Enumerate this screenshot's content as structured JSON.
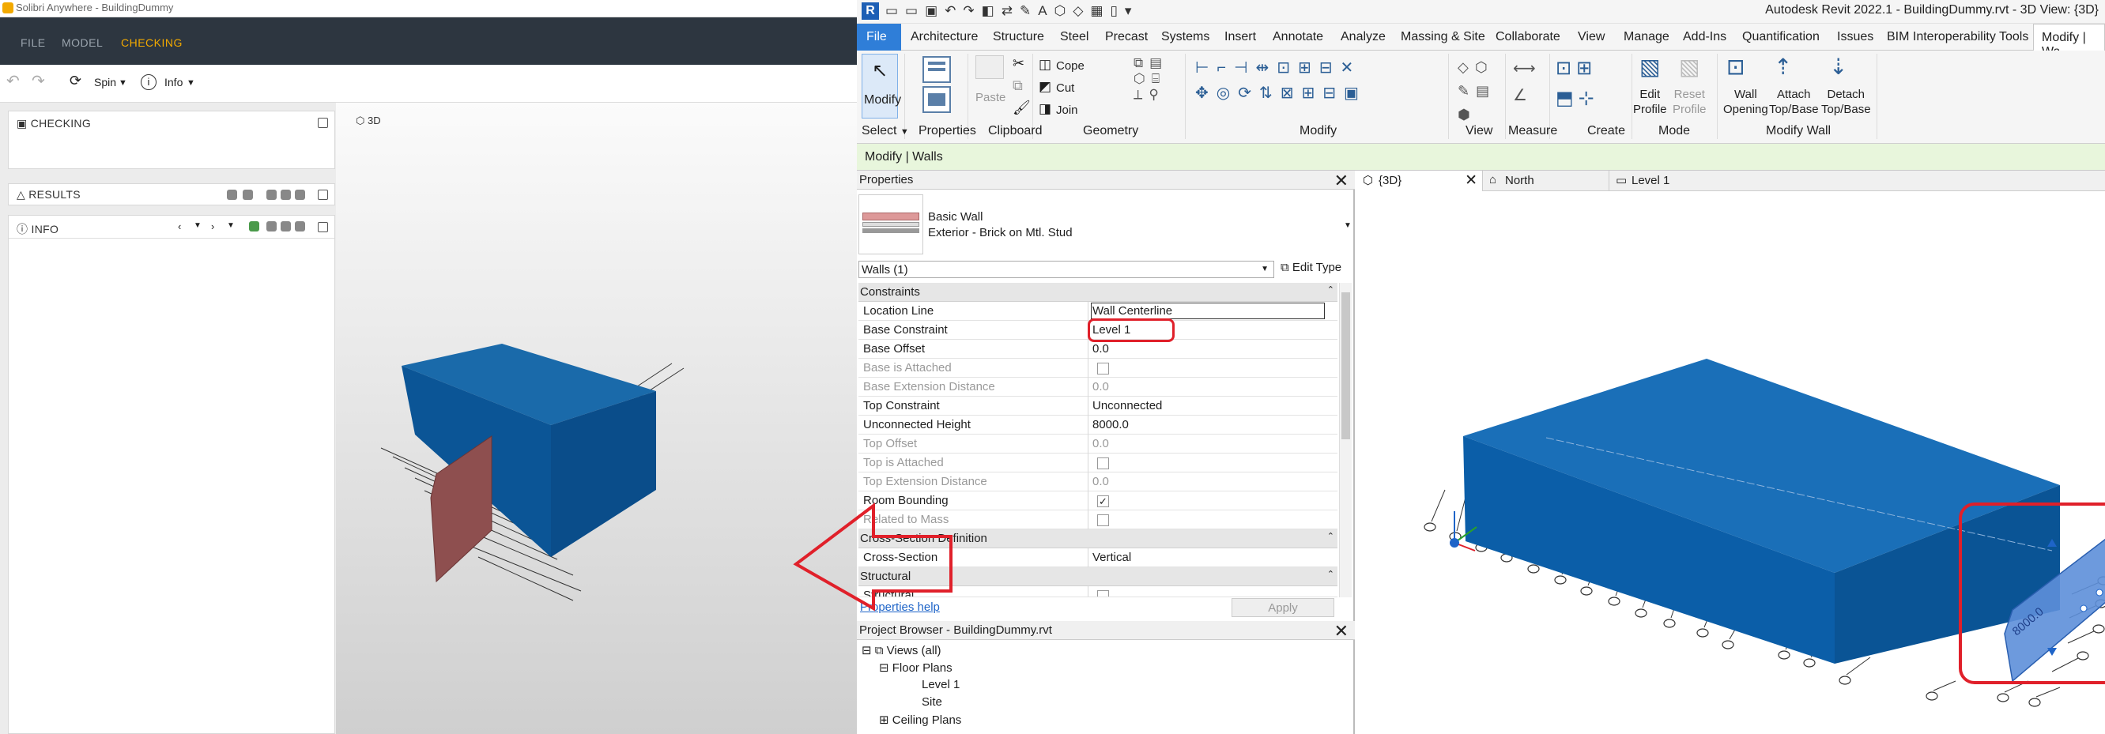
{
  "solibri": {
    "title": "Solibri Anywhere - BuildingDummy",
    "menu": [
      "FILE",
      "MODEL",
      "CHECKING"
    ],
    "toolbar": {
      "spin": "Spin",
      "info": "Info"
    },
    "panels": {
      "checking": "CHECKING",
      "results": "RESULTS",
      "info": "INFO"
    },
    "view_label": "3D"
  },
  "revit": {
    "title": "Autodesk Revit 2022.1 - BuildingDummy.rvt - 3D View: {3D}",
    "tabs": [
      "File",
      "Architecture",
      "Structure",
      "Steel",
      "Precast",
      "Systems",
      "Insert",
      "Annotate",
      "Analyze",
      "Massing & Site",
      "Collaborate",
      "View",
      "Manage",
      "Add-Ins",
      "Quantification",
      "Issues",
      "BIM Interoperability Tools",
      "Modify | Wa"
    ],
    "ribbon": {
      "modify": "Modify",
      "paste": "Paste",
      "cope": "Cope",
      "cut": "Cut",
      "join": "Join",
      "edit_profile": "Edit\nProfile",
      "reset_profile": "Reset\nProfile",
      "wall_opening": "Wall\nOpening",
      "attach": "Attach\nTop/Base",
      "detach": "Detach\nTop/Base",
      "groups": [
        "Select",
        "Properties",
        "Clipboard",
        "Geometry",
        "Modify",
        "View",
        "Measure",
        "Create",
        "Mode",
        "Modify Wall"
      ]
    },
    "context_bar": "Modify | Walls",
    "properties": {
      "title": "Properties",
      "type_family": "Basic Wall",
      "type_name": "Exterior - Brick on Mtl. Stud",
      "selector": "Walls (1)",
      "edit_type": "Edit Type",
      "categories": {
        "constraints": "Constraints",
        "cross_section": "Cross-Section Definition",
        "structural": "Structural"
      },
      "rows": [
        {
          "name": "Location Line",
          "value": "Wall Centerline"
        },
        {
          "name": "Base Constraint",
          "value": "Level 1"
        },
        {
          "name": "Base Offset",
          "value": "0.0"
        },
        {
          "name": "Base is Attached",
          "value": ""
        },
        {
          "name": "Base Extension Distance",
          "value": "0.0"
        },
        {
          "name": "Top Constraint",
          "value": "Unconnected"
        },
        {
          "name": "Unconnected Height",
          "value": "8000.0"
        },
        {
          "name": "Top Offset",
          "value": "0.0"
        },
        {
          "name": "Top is Attached",
          "value": ""
        },
        {
          "name": "Top Extension Distance",
          "value": "0.0"
        },
        {
          "name": "Room Bounding",
          "value": ""
        },
        {
          "name": "Related to Mass",
          "value": ""
        },
        {
          "name": "Cross-Section",
          "value": "Vertical"
        },
        {
          "name": "Structural",
          "value": ""
        }
      ],
      "help": "Properties help",
      "apply": "Apply"
    },
    "project_browser": {
      "title": "Project Browser - BuildingDummy.rvt",
      "items": [
        "Views (all)",
        "Floor Plans",
        "Level 1",
        "Site",
        "Ceiling Plans"
      ]
    },
    "view_tabs": [
      "{3D}",
      "North",
      "Level 1"
    ],
    "dimension": "8000.0"
  },
  "colors": {
    "building_blue": "#0a5aa0",
    "wall_red": "#8e4f4f",
    "highlight": "#e0202a",
    "file_tab": "#2f7ed8"
  }
}
